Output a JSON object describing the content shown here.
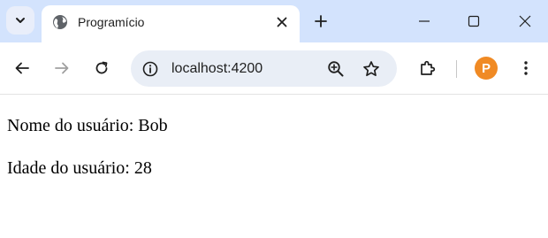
{
  "tab": {
    "title": "Programício"
  },
  "toolbar": {
    "url": "localhost:4200",
    "avatar_letter": "P"
  },
  "page": {
    "name_line": "Nome do usuário: Bob",
    "age_line": "Idade do usuário: 28"
  },
  "colors": {
    "tabstrip_bg": "#d3e3fd",
    "omnibox_bg": "#e9eef6",
    "avatar_bg": "#f08a24"
  }
}
